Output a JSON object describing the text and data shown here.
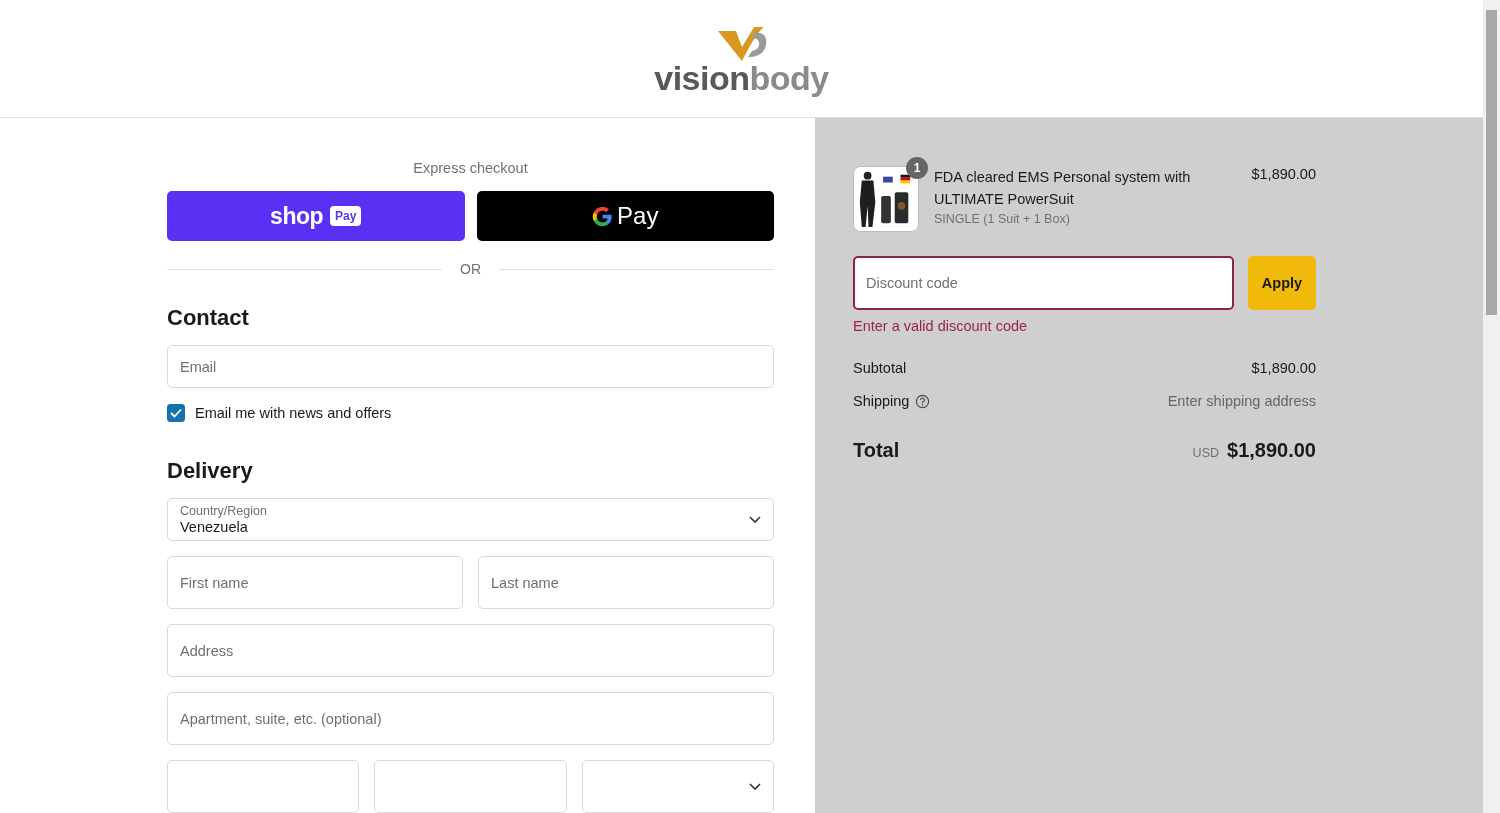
{
  "header": {
    "logo": {
      "part_1": "vision",
      "part_2": "body"
    }
  },
  "express_checkout": {
    "title": "Express checkout",
    "divider": "OR",
    "buttons": [
      {
        "kind": "shop_pay",
        "label_1": "shop",
        "label_2": "Pay"
      },
      {
        "kind": "google_pay",
        "label": "Pay"
      }
    ]
  },
  "contact": {
    "heading": "Contact",
    "email": {
      "placeholder": "Email"
    },
    "newsletter": {
      "label": "Email me with news and offers",
      "checked": true
    }
  },
  "delivery": {
    "heading": "Delivery",
    "country": {
      "label": "Country/Region",
      "value": "Venezuela"
    },
    "rows": [
      {
        "fields": [
          {
            "kind": "text",
            "placeholder": "First name"
          },
          {
            "kind": "text",
            "placeholder": "Last name"
          }
        ]
      },
      {
        "fields": [
          {
            "kind": "text",
            "placeholder": "Address"
          }
        ]
      },
      {
        "fields": [
          {
            "kind": "text",
            "placeholder": "Apartment, suite, etc. (optional)"
          }
        ]
      },
      {
        "fields": [
          {
            "kind": "text"
          },
          {
            "kind": "text"
          },
          {
            "kind": "select"
          }
        ]
      }
    ]
  },
  "summary": {
    "items": [
      {
        "title": "FDA cleared EMS Personal system with ULTIMATE PowerSuit",
        "variant": "SINGLE (1 Suit + 1 Box)",
        "price": "$1,890.00",
        "quantity": "1"
      }
    ],
    "discount": {
      "placeholder": "Discount code",
      "invalid": true,
      "error": "Enter a valid discount code",
      "button": "Apply"
    },
    "lines": [
      {
        "label": "Subtotal",
        "value": "$1,890.00",
        "help": false,
        "muted": false
      },
      {
        "label": "Shipping",
        "value": "Enter shipping address",
        "help": true,
        "muted": true
      }
    ],
    "total": {
      "label": "Total",
      "currency": "USD",
      "value": "$1,890.00"
    }
  }
}
